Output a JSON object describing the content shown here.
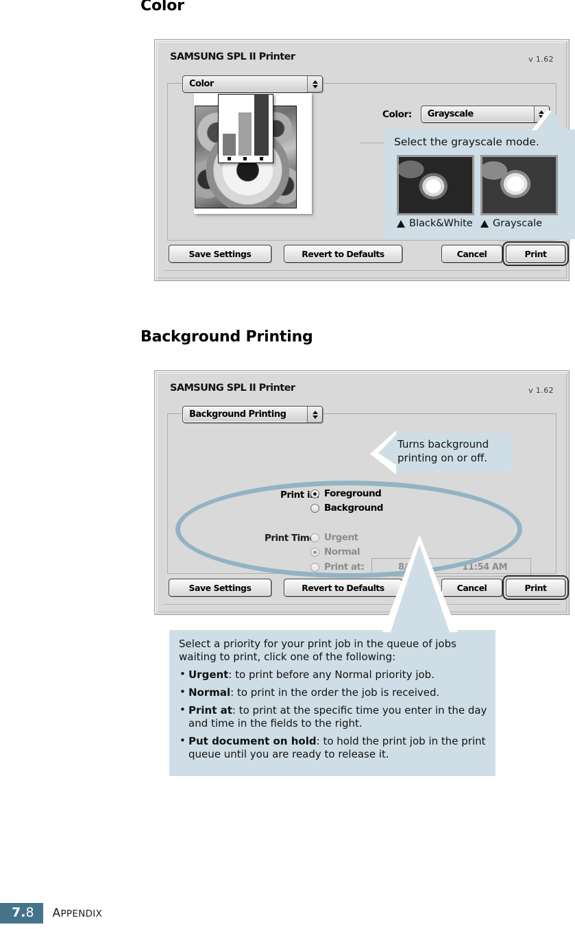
{
  "page": {
    "headings": {
      "color": "Color",
      "background_printing": "Background Printing"
    },
    "footer": {
      "page_number_major": "7.",
      "page_number_minor": "8",
      "section_first_letter": "A",
      "section_rest": "PPENDIX"
    }
  },
  "dialog_color": {
    "title": "SAMSUNG SPL II Printer",
    "version": "v 1.62",
    "panel_popup": {
      "selected": "Color",
      "options": [
        "Color"
      ]
    },
    "color_field": {
      "label": "Color:",
      "selected": "Grayscale",
      "options": [
        "Grayscale"
      ]
    },
    "preview": {
      "chart": {
        "bars": [
          32,
          63,
          90
        ],
        "ticks": 3
      }
    },
    "buttons": {
      "save": "Save Settings",
      "revert": "Revert to Defaults",
      "cancel": "Cancel",
      "print": "Print"
    }
  },
  "dialog_background": {
    "title": "SAMSUNG SPL II Printer",
    "version": "v 1.62",
    "panel_popup": {
      "selected": "Background Printing",
      "options": [
        "Background Printing"
      ]
    },
    "print_in": {
      "label": "Print in:",
      "options": [
        {
          "label": "Foreground",
          "selected": true,
          "enabled": true
        },
        {
          "label": "Background",
          "selected": false,
          "enabled": true
        }
      ]
    },
    "print_time": {
      "label": "Print Time:",
      "options": [
        {
          "label": "Urgent",
          "selected": false,
          "enabled": false
        },
        {
          "label": "Normal",
          "selected": true,
          "enabled": false
        },
        {
          "label": "Print at:",
          "selected": false,
          "enabled": false
        },
        {
          "label": "Put document on hold",
          "selected": false,
          "enabled": false
        }
      ],
      "date_value": "8/  5/02",
      "time_value": "11:54 AM"
    },
    "buttons": {
      "save": "Save Settings",
      "revert": "Revert to Defaults",
      "cancel": "Cancel",
      "print": "Print"
    }
  },
  "callouts": {
    "grayscale": {
      "title": "Select the grayscale mode.",
      "thumbnails": [
        {
          "caption": "Black&White"
        },
        {
          "caption": "Grayscale"
        }
      ]
    },
    "background_toggle": {
      "text": "Turns background printing on or off."
    },
    "priority": {
      "intro": "Select a priority for your print job in the queue of jobs waiting to print, click one of the following:",
      "bullets": [
        {
          "term": "Urgent",
          "desc": ": to print before any Normal priority job."
        },
        {
          "term": "Normal",
          "desc": ": to print in the order the job is received."
        },
        {
          "term": "Print at",
          "desc": ": to print at the specific time you enter in the day and time in the fields to the right."
        },
        {
          "term": "Put document on hold",
          "desc": ": to hold the print job in the print queue until you are ready to release it."
        }
      ]
    }
  },
  "colors": {
    "callout_bg": "#cfdee6",
    "highlight_ellipse": "#93b3c4",
    "footer_badge": "#44738c",
    "dialog_bg": "#d9d9d9"
  }
}
